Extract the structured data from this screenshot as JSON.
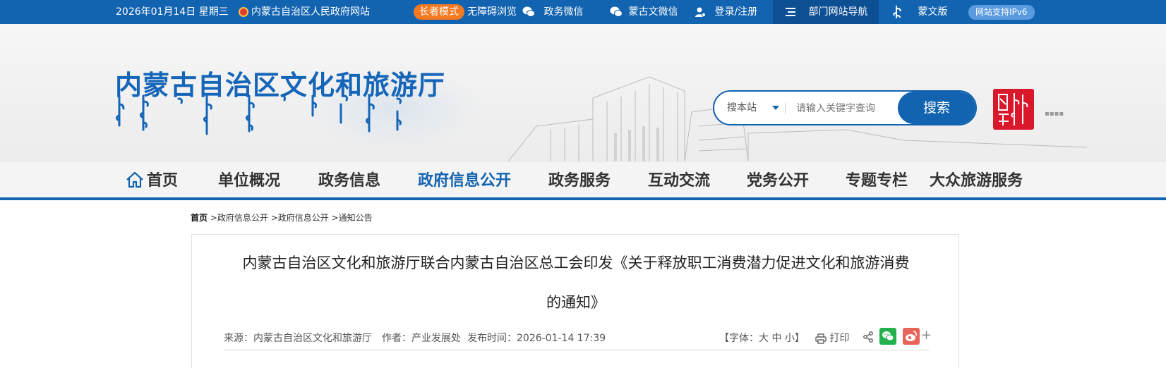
{
  "topbar": {
    "date": "2026年01月14日 星期三",
    "gov_portal": "内蒙古自治区人民政府网站",
    "elder_mode": "长者模式",
    "accessible": "无障碍浏览",
    "wechat": "政务微信",
    "mongolian_wechat": "蒙古文微信",
    "login": "登录/注册",
    "dept_nav": "部门网站导航",
    "mongolian_version": "蒙文版",
    "ipv6": "网站支持IPv6"
  },
  "header": {
    "site_title": "内蒙古自治区文化和旅游厅",
    "search": {
      "scope": "搜本站",
      "placeholder": "请输入关键字查询",
      "button": "搜索"
    }
  },
  "nav": {
    "items": [
      {
        "label": "首页"
      },
      {
        "label": "单位概况"
      },
      {
        "label": "政务信息"
      },
      {
        "label": "政府信息公开"
      },
      {
        "label": "政务服务"
      },
      {
        "label": "互动交流"
      },
      {
        "label": "党务公开"
      },
      {
        "label": "专题专栏"
      },
      {
        "label": "大众旅游服务"
      }
    ],
    "active": "政府信息公开"
  },
  "breadcrumb": [
    "首页",
    "政府信息公开",
    "政府信息公开",
    "通知公告"
  ],
  "article": {
    "title_line1": "内蒙古自治区文化和旅游厅联合内蒙古自治区总工会印发《关于释放职工消费潜力促进文化和旅游消费",
    "title_line2": "的通知》",
    "source": "来源：内蒙古自治区文化和旅游厅",
    "author": "作者：产业发展处",
    "published": "发布时间：2026-01-14 17:39",
    "font_size": "【字体：大 中 小】",
    "print": "打印",
    "more": "+"
  },
  "colors": {
    "brand_blue": "#1263b0",
    "elder_orange": "#f47920",
    "wechat_green": "#22b14c",
    "weibo_red": "#e8645a"
  }
}
